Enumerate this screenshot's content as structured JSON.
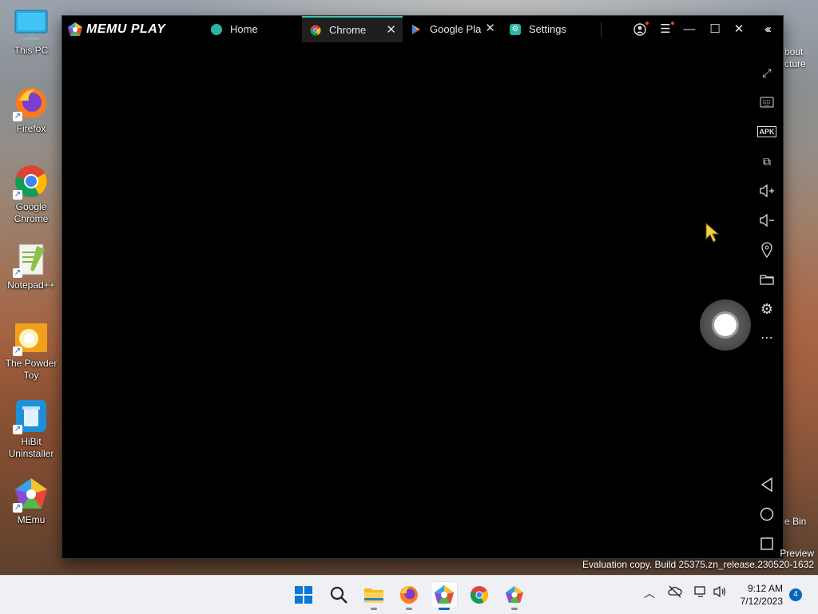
{
  "desktop": {
    "icons": [
      {
        "label": "This PC"
      },
      {
        "label": "Firefox"
      },
      {
        "label": "Google Chrome"
      },
      {
        "label": "Notepad++"
      },
      {
        "label": "The Powder Toy"
      },
      {
        "label": "HiBit Uninstaller"
      },
      {
        "label": "MEmu"
      }
    ],
    "right_partial": {
      "about": "bout",
      "picture": "cture",
      "recycle": "e Bin"
    }
  },
  "emulator": {
    "logo_text": "MEMU PLAY",
    "tabs": [
      {
        "label": "Home",
        "icon": "memu-home-icon",
        "color": "#2bb3a3",
        "closable": false
      },
      {
        "label": "Chrome",
        "icon": "chrome-icon",
        "color": "#4285f4",
        "closable": true,
        "active": true
      },
      {
        "label": "Google Play",
        "icon": "google-play-icon",
        "color": "#34a853",
        "closable": true
      },
      {
        "label": "Settings",
        "icon": "settings-icon",
        "color": "#2bb3a3",
        "closable": false
      }
    ],
    "toolbar": [
      "fullscreen-icon",
      "keyboard-icon",
      "apk-icon",
      "multi-window-icon",
      "volume-up-icon",
      "volume-down-icon",
      "location-icon",
      "folder-icon",
      "gear-icon",
      "more-icon"
    ],
    "nav": [
      "back-icon",
      "home-circle-icon",
      "recents-icon"
    ],
    "apk_label": "APK"
  },
  "watermark": {
    "preview": "Preview",
    "evaluation": "Evaluation copy. Build 25375.zn_release.230520-1632"
  },
  "taskbar": {
    "apps": [
      "start-icon",
      "search-icon",
      "file-explorer-icon",
      "firefox-icon",
      "memu-icon",
      "chrome-icon",
      "memu-multi-icon"
    ],
    "clock_time": "9:12 AM",
    "clock_date": "7/12/2023",
    "notification_count": "4",
    "accent": "#0067c0"
  }
}
